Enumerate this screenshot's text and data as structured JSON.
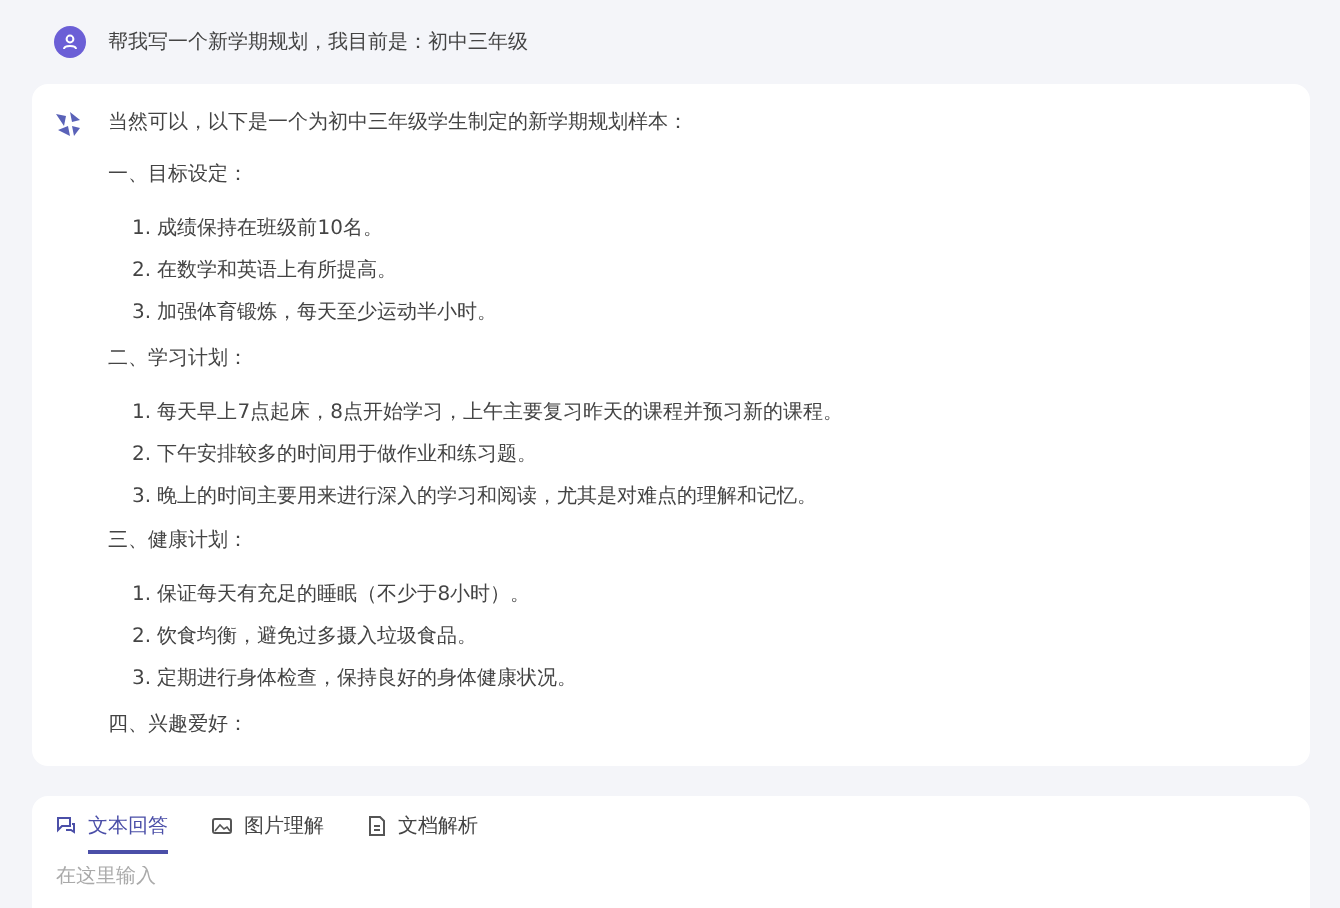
{
  "user_message": {
    "text": "帮我写一个新学期规划，我目前是：初中三年级"
  },
  "answer": {
    "intro": "当然可以，以下是一个为初中三年级学生制定的新学期规划样本：",
    "sections": [
      {
        "heading": "一、目标设定：",
        "items": [
          "1. 成绩保持在班级前10名。",
          "2. 在数学和英语上有所提高。",
          "3. 加强体育锻炼，每天至少运动半小时。"
        ]
      },
      {
        "heading": "二、学习计划：",
        "items": [
          "1. 每天早上7点起床，8点开始学习，上午主要复习昨天的课程并预习新的课程。",
          "2. 下午安排较多的时间用于做作业和练习题。",
          "3. 晚上的时间主要用来进行深入的学习和阅读，尤其是对难点的理解和记忆。"
        ]
      },
      {
        "heading": "三、健康计划：",
        "items": [
          "1. 保证每天有充足的睡眠（不少于8小时）。",
          "2. 饮食均衡，避免过多摄入垃圾食品。",
          "3. 定期进行身体检查，保持良好的身体健康状况。"
        ]
      },
      {
        "heading": "四、兴趣爱好："
      }
    ]
  },
  "input": {
    "tabs": [
      {
        "label": "文本回答",
        "kind": "text",
        "selected": true
      },
      {
        "label": "图片理解",
        "kind": "image",
        "selected": false
      },
      {
        "label": "文档解析",
        "kind": "doc",
        "selected": false
      }
    ],
    "placeholder": "在这里输入"
  }
}
